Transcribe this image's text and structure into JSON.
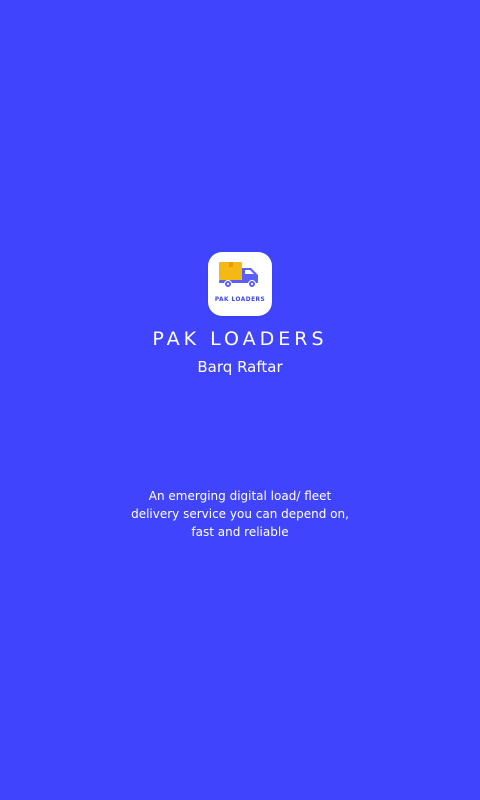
{
  "app": {
    "logo_text": "PAK LOADERS",
    "title": "PAK LOADERS",
    "tagline": "Barq Raftar",
    "description_lines": [
      "An emerging digital load/ fleet",
      "delivery service you can depend on,",
      "fast and reliable"
    ]
  },
  "icons": {
    "logo": "delivery-truck-icon"
  },
  "colors": {
    "background": "#4045fd",
    "logo_background": "#ffffff",
    "box": "#f4b914",
    "truck": "#5b5ffc",
    "text": "#ffffff"
  }
}
